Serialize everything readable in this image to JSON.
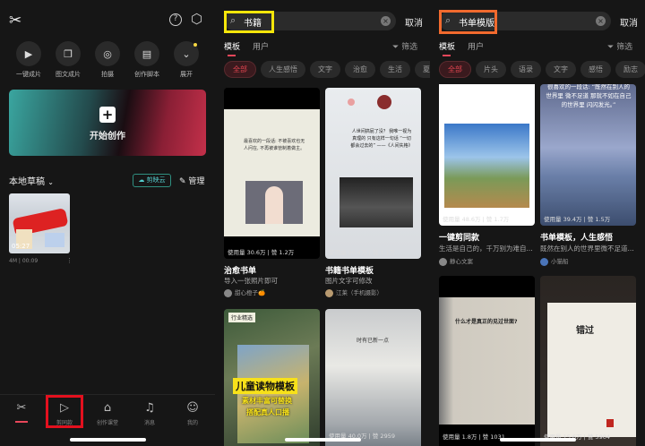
{
  "home": {
    "header_icons": [
      "capcut-logo",
      "help-icon",
      "settings-icon"
    ],
    "quick_actions": [
      {
        "label": "一键成片",
        "icon": "play-icon"
      },
      {
        "label": "图文成片",
        "icon": "image-text-icon"
      },
      {
        "label": "拍摄",
        "icon": "camera-icon"
      },
      {
        "label": "创作脚本",
        "icon": "script-icon"
      },
      {
        "label": "展开",
        "icon": "chevron-down-icon"
      }
    ],
    "start_label": "开始创作",
    "drafts_title": "本地草稿",
    "cloud_label": "剪映云",
    "manage_label": "管理",
    "draft": {
      "duration": "05:27",
      "size": "4M",
      "time": "00:09"
    },
    "nav": [
      {
        "label": "",
        "icon": "scissors-icon"
      },
      {
        "label": "剪同款",
        "icon": "template-icon"
      },
      {
        "label": "创作课堂",
        "icon": "graduation-cap-icon"
      },
      {
        "label": "消息",
        "icon": "bell-icon"
      },
      {
        "label": "我的",
        "icon": "user-icon"
      }
    ],
    "accent": "#e8475a",
    "highlight_box": "#e3101e"
  },
  "search1": {
    "query": "书籍",
    "cancel": "取消",
    "tabs": [
      "模板",
      "用户"
    ],
    "filter": "筛选",
    "highlight_box": "#f5e60a",
    "chips": [
      "全部",
      "人生感悟",
      "文字",
      "治愈",
      "生活",
      "夏日"
    ],
    "cards": [
      {
        "stats": "使用量 30.6万 | 赞 1.2万",
        "title": "治愈书单",
        "subtitle": "导入一张照片即可",
        "author": "甜心橙子🍊",
        "page": "最喜欢的一段话: 不被喜欢也无人问在, 不再被谁管制着做主。"
      },
      {
        "stats": "使用量 90.4万 | 赞 1.1万",
        "title": "书籍书单模板",
        "subtitle": "图片文字可修改",
        "author": "江莱（手机摄影）",
        "page": "人世间搞屁了没？ 我唯一视为真理的 只有这样一句话 “一切都会过去的” ——《人间失格》"
      },
      {
        "stats": "",
        "badge": "行业精选",
        "headline": "儿童读物模板",
        "lines": [
          "素材丰富可替换",
          "搭配真人口播"
        ]
      },
      {
        "stats": "使用量 40.0万 | 赞 2959",
        "page_title": "时有已新一点"
      }
    ]
  },
  "search2": {
    "query": "书单模版",
    "cancel": "取消",
    "tabs": [
      "模板",
      "用户"
    ],
    "filter": "筛选",
    "highlight_box": "#f26a2e",
    "chips": [
      "全部",
      "片头",
      "语录",
      "文字",
      "感悟",
      "励志",
      "治愈"
    ],
    "cards": [
      {
        "stats": "使用量 48.6万 | 赞 1.7万",
        "title": "一键剪同款",
        "subtitle": "生活是自己的，千万别为难自...",
        "author": "静心文案"
      },
      {
        "stats": "使用量 39.4万 | 赞 1.5万",
        "title": "书单模板，人生感悟",
        "subtitle": "既然在别人的世界里微不足道...",
        "author": "小猫船",
        "page": "很喜欢的一段话: “既然在别人的世界里 微不足道 那就不如在自己的世界里 闪闪发光。”"
      },
      {
        "stats": "使用量 1.8万 | 赞 1031",
        "page_title": "什么才是真正的见过世面?"
      },
      {
        "stats": "使用量 15.6万 | 赞 5904",
        "page_title": "错过"
      }
    ]
  }
}
